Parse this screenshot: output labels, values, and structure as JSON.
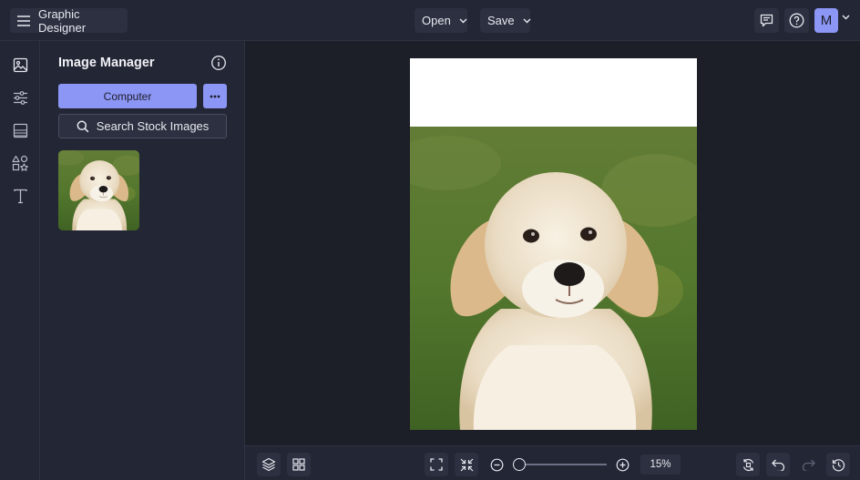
{
  "topbar": {
    "app_title": "Graphic Designer",
    "open_label": "Open",
    "save_label": "Save",
    "user_initial": "M"
  },
  "rail": {
    "items": [
      {
        "icon": "image-icon"
      },
      {
        "icon": "sliders-icon"
      },
      {
        "icon": "layout-icon"
      },
      {
        "icon": "shapes-icon"
      },
      {
        "icon": "text-icon"
      }
    ]
  },
  "panel": {
    "title": "Image Manager",
    "computer_label": "Computer",
    "search_stock_label": "Search Stock Images"
  },
  "bottombar": {
    "zoom_level": 0.15,
    "zoom_label": "15%"
  },
  "colors": {
    "accent": "#8c96f5",
    "background": "#1c1e28",
    "surface": "#232634",
    "control": "#2d3040"
  }
}
